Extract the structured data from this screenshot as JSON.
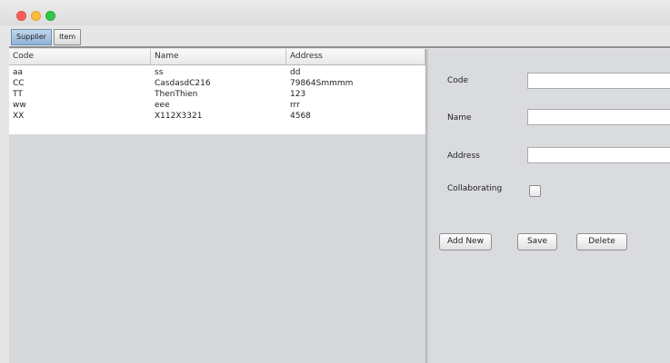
{
  "window": {
    "traffic_lights": [
      "close",
      "minimize",
      "zoom"
    ]
  },
  "tabs": [
    {
      "label": "Supplier",
      "active": true
    },
    {
      "label": "Item",
      "active": false
    }
  ],
  "table": {
    "headers": [
      "Code",
      "Name",
      "Address"
    ],
    "rows": [
      [
        "aa",
        "ss",
        "dd"
      ],
      [
        "CC",
        "CasdasdC216",
        "79864Smmmm"
      ],
      [
        "TT",
        "ThenThien",
        "123"
      ],
      [
        "ww",
        "eee",
        "rrr"
      ],
      [
        "XX",
        "X112X3321",
        "4568"
      ]
    ]
  },
  "form": {
    "code_label": "Code",
    "name_label": "Name",
    "address_label": "Address",
    "collaborating_label": "Collaborating",
    "code_value": "",
    "name_value": "",
    "address_value": "",
    "collaborating_checked": false
  },
  "buttons": {
    "add_new": "Add New",
    "save": "Save",
    "delete": "Delete"
  },
  "colors": {
    "active_tab": "#9fbde0",
    "background": "#d7d9dd",
    "table_bg": "#ffffff"
  }
}
